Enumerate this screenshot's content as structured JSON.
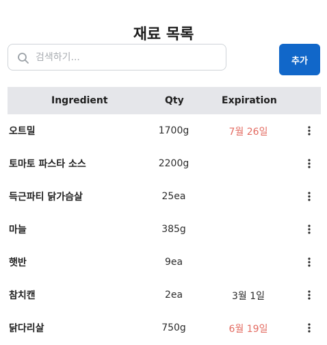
{
  "page": {
    "title": "재료 목록"
  },
  "search": {
    "placeholder": "검색하기...",
    "value": "",
    "icon": "search-icon"
  },
  "toolbar": {
    "add_label": "추가",
    "accent_color": "#1167c9"
  },
  "table": {
    "headers": {
      "ingredient": "Ingredient",
      "qty": "Qty",
      "expiration": "Expiration"
    },
    "rows": [
      {
        "name": "오트밀",
        "qty": "1700g",
        "expiration": "7월 26일",
        "expiration_status": "warn"
      },
      {
        "name": "토마토 파스타 소스",
        "qty": "2200g",
        "expiration": "",
        "expiration_status": "none"
      },
      {
        "name": "득근파티 닭가슴살",
        "qty": "25ea",
        "expiration": "",
        "expiration_status": "none"
      },
      {
        "name": "마늘",
        "qty": "385g",
        "expiration": "",
        "expiration_status": "none"
      },
      {
        "name": "햇반",
        "qty": "9ea",
        "expiration": "",
        "expiration_status": "none"
      },
      {
        "name": "참치캔",
        "qty": "2ea",
        "expiration": "3월 1일",
        "expiration_status": "normal"
      },
      {
        "name": "닭다리살",
        "qty": "750g",
        "expiration": "6월 19일",
        "expiration_status": "warn"
      }
    ],
    "warn_color": "#e36b61"
  }
}
